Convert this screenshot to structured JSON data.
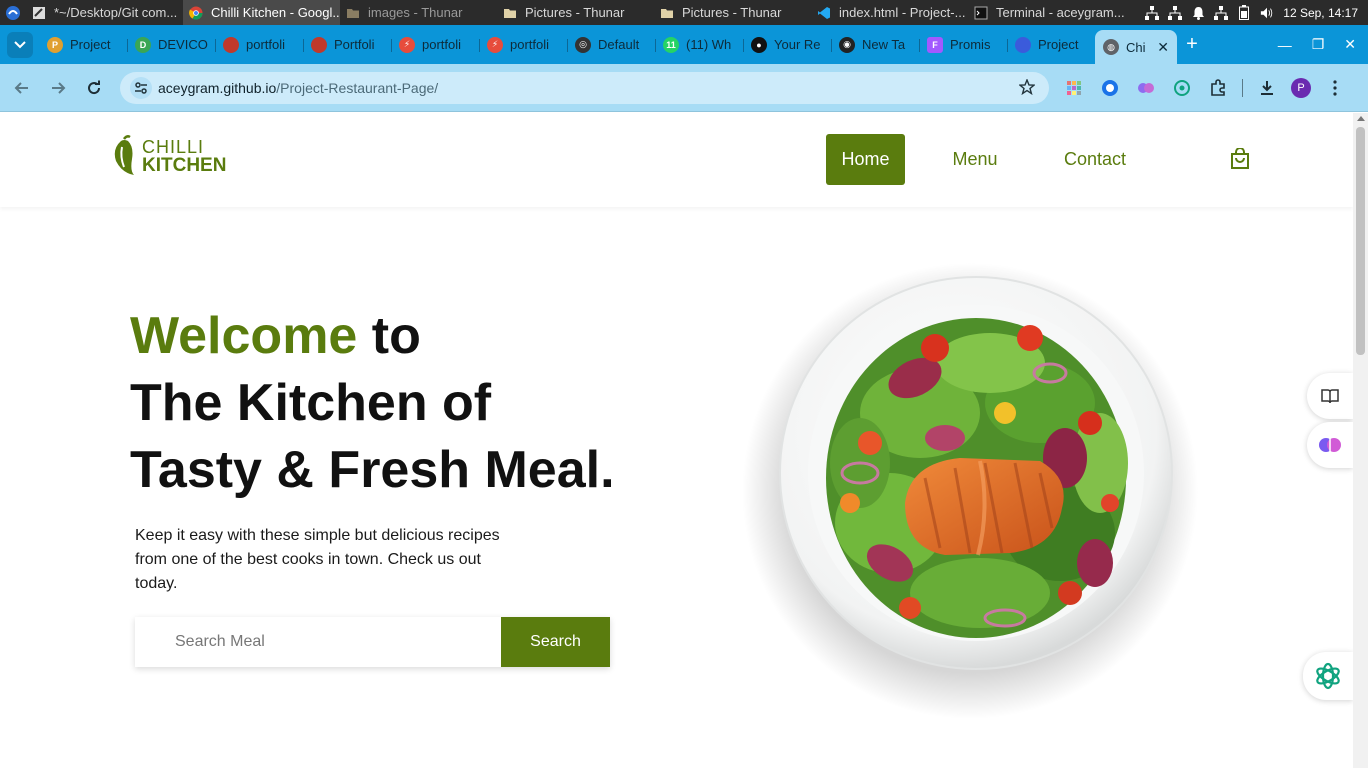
{
  "taskbar": {
    "tasks": [
      {
        "label": "*~/Desktop/Git com...",
        "icon": "text-editor-icon"
      },
      {
        "label": "Chilli Kitchen - Googl...",
        "icon": "chrome-icon"
      },
      {
        "label": "images - Thunar",
        "icon": "folder-icon"
      },
      {
        "label": "Pictures - Thunar",
        "icon": "folder-icon"
      },
      {
        "label": "Pictures - Thunar",
        "icon": "folder-icon"
      },
      {
        "label": "index.html - Project-...",
        "icon": "vscode-icon"
      },
      {
        "label": "Terminal - aceygram...",
        "icon": "terminal-icon"
      }
    ],
    "clock": "12 Sep, 14:17"
  },
  "browser": {
    "tabs": [
      {
        "label": "Project",
        "favicon": "#e0a030"
      },
      {
        "label": "DEVICO",
        "favicon": "#3aa655"
      },
      {
        "label": "portfoli",
        "favicon": "#c0392b"
      },
      {
        "label": "Portfoli",
        "favicon": "#c0392b"
      },
      {
        "label": "portfoli",
        "favicon": "#e74c3c"
      },
      {
        "label": "portfoli",
        "favicon": "#e74c3c"
      },
      {
        "label": "Default",
        "favicon": "#333333"
      },
      {
        "label": "(11) Wh",
        "favicon": "#25d366"
      },
      {
        "label": "Your Re",
        "favicon": "#111111"
      },
      {
        "label": "New Ta",
        "favicon": "#222222"
      },
      {
        "label": "Promis",
        "favicon": "#a259ff"
      },
      {
        "label": "Project",
        "favicon": "#3b5bdb"
      }
    ],
    "active_tab": {
      "label": "Chi",
      "favicon": "#5f6368"
    },
    "url_host": "aceygram.github.io",
    "url_path": "/Project-Restaurant-Page/",
    "profile_initial": "P"
  },
  "site": {
    "logo": {
      "line1": "CHILLI",
      "line2": "KITCHEN"
    },
    "nav": {
      "home": "Home",
      "menu": "Menu",
      "contact": "Contact"
    },
    "hero": {
      "title_accent": "Welcome",
      "title_rest_1": " to",
      "title_line_2": "The Kitchen of",
      "title_line_3": "Tasty & Fresh Meal.",
      "description": "Keep it easy with these simple but delicious recipes from one of the best cooks in town. Check us out today."
    },
    "search": {
      "placeholder": "Search Meal",
      "button": "Search"
    },
    "colors": {
      "accent": "#5a7c0e"
    }
  }
}
